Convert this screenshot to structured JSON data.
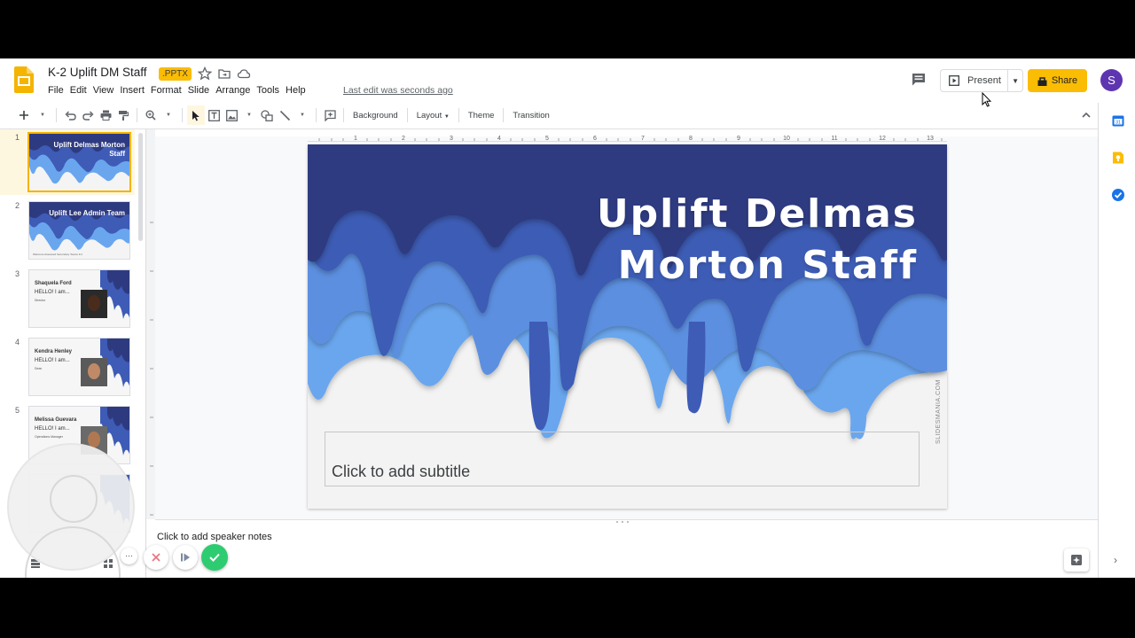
{
  "doc": {
    "title": "K-2 Uplift DM Staff",
    "badge": ".PPTX"
  },
  "menu": [
    "File",
    "Edit",
    "View",
    "Insert",
    "Format",
    "Slide",
    "Arrange",
    "Tools",
    "Help"
  ],
  "last_edit": "Last edit was seconds ago",
  "header": {
    "present_label": "Present",
    "share_label": "Share",
    "avatar_initial": "S"
  },
  "toolbar": {
    "background": "Background",
    "layout": "Layout",
    "theme": "Theme",
    "transition": "Transition"
  },
  "ruler": {
    "h_ticks": [
      "1",
      "2",
      "3",
      "4",
      "5",
      "6",
      "7",
      "8",
      "9",
      "10",
      "11",
      "12",
      "13"
    ],
    "v_ticks": [
      "1",
      "2",
      "3",
      "4",
      "5",
      "6",
      "7"
    ]
  },
  "slides": [
    {
      "num": "1",
      "title": "Uplift Delmas Morton Staff"
    },
    {
      "num": "2",
      "title": "Uplift Lee Admin Team",
      "sub": "Welcome Assessed Secondary Teams 1/1"
    },
    {
      "num": "3",
      "name": "Shaquela Ford",
      "hello": "HELLO! I am...",
      "role": "Director"
    },
    {
      "num": "4",
      "name": "Kendra Henley",
      "hello": "HELLO! I am...",
      "role": "Dean"
    },
    {
      "num": "5",
      "name": "Melissa Guevara",
      "hello": "HELLO! I am...",
      "role": "Operations Manager"
    }
  ],
  "main_slide": {
    "title_line1": "Uplift Delmas",
    "title_line2": "Morton Staff",
    "subtitle_placeholder": "Click to add subtitle",
    "watermark": "SLIDESMANIA.COM"
  },
  "notes": {
    "placeholder": "Click to add speaker notes"
  },
  "colors": {
    "accent": "#fbbc04",
    "avatar": "#5e35b1",
    "drip_dark": "#2e3a80",
    "drip_mid": "#3e5bb5",
    "drip_light": "#5b8fe0",
    "drip_pale": "#6aa6ee"
  }
}
